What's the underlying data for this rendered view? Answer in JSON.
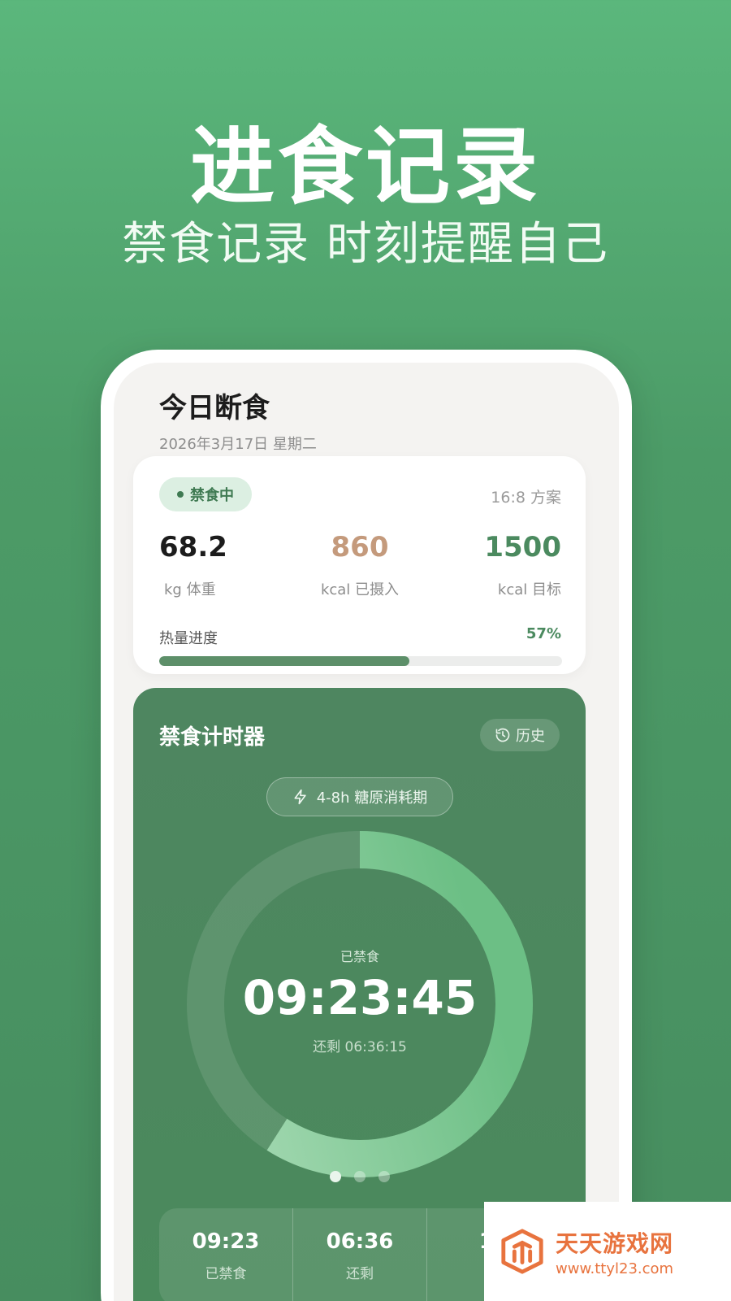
{
  "promo": {
    "headline": "进食记录",
    "subline": "禁食记录 时刻提醒自己"
  },
  "screen": {
    "title": "今日断食",
    "date": "2026年3月17日 星期二"
  },
  "summary_card": {
    "status": "禁食中",
    "plan": "16:8 方案",
    "weight": {
      "value": "68.2",
      "unit": "kg 体重"
    },
    "intake": {
      "value": "860",
      "unit": "kcal 已摄入"
    },
    "target": {
      "value": "1500",
      "unit": "kcal 目标"
    },
    "progress_label": "热量进度",
    "progress_text": "57%",
    "progress_fraction": 0.62
  },
  "timer": {
    "title": "禁食计时器",
    "history_label": "历史",
    "phase": "4-8h 糖原消耗期",
    "elapsed_label": "已禁食",
    "elapsed": "09:23:45",
    "remaining": "还剩 06:36:15",
    "ring_fraction": 0.59,
    "pages": 3,
    "active_page": 0,
    "stats": [
      {
        "value": "09:23",
        "label": "已禁食"
      },
      {
        "value": "06:36",
        "label": "还剩"
      },
      {
        "value": "16",
        "label": ""
      }
    ]
  },
  "watermark": {
    "name": "天天游戏网",
    "url": "www.ttyl23.com"
  },
  "colors": {
    "accent": "#4b8a5f",
    "intake": "#c49a7c",
    "ring_start": "#a9dbb6",
    "ring_end": "#6cbf85",
    "watermark": "#e8733e"
  }
}
